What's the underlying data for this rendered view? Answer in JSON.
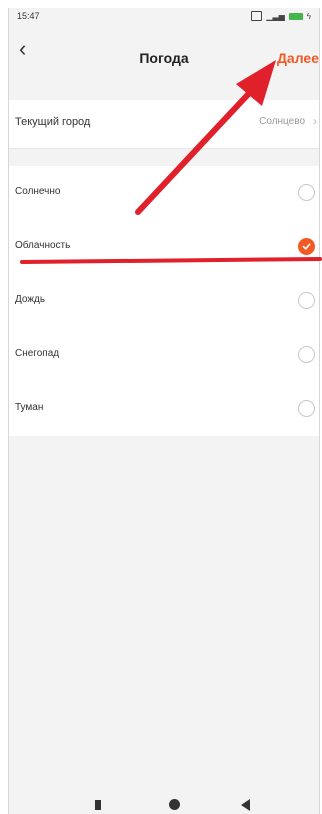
{
  "status_bar": {
    "time": "15:47"
  },
  "header": {
    "back_icon": "chevron-left-icon",
    "title": "Погода",
    "next_label": "Далее"
  },
  "city": {
    "label": "Текущий город",
    "value": "Солнцево",
    "chevron_icon": "chevron-right-icon"
  },
  "options": [
    {
      "label": "Солнечно",
      "checked": false
    },
    {
      "label": "Облачность",
      "checked": true
    },
    {
      "label": "Дождь",
      "checked": false
    },
    {
      "label": "Снегопад",
      "checked": false
    },
    {
      "label": "Туман",
      "checked": false
    }
  ],
  "colors": {
    "accent": "#f15a24",
    "annotation": "#e0202a",
    "background": "#f3f3f3"
  },
  "annotations": {
    "arrow": "red-arrow-to-next-button",
    "underline": "red-underline-under-cloudiness"
  }
}
